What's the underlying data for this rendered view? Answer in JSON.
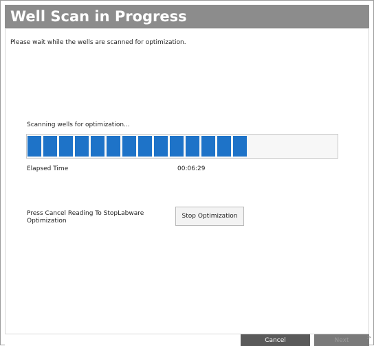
{
  "header": {
    "title": "Well Scan in Progress"
  },
  "subtitle": "Please wait while the wells are scanned for optimization.",
  "scan": {
    "status": "Scanning wells for optimization...",
    "progress_segments_filled": 14,
    "progress_segments_total": 19,
    "elapsed_label": "Elapsed Time",
    "elapsed_value": "00:06:29"
  },
  "stop": {
    "instruction": "Press Cancel Reading To StopLabware Optimization",
    "button_label": "Stop Optimization"
  },
  "footer": {
    "cancel_label": "Cancel",
    "next_label": "Next",
    "next_arrow": ">"
  },
  "colors": {
    "header_bg": "#8c8c8c",
    "progress_fill": "#1e73c8"
  },
  "icons": {
    "next_arrow": "chevron-right-icon"
  }
}
